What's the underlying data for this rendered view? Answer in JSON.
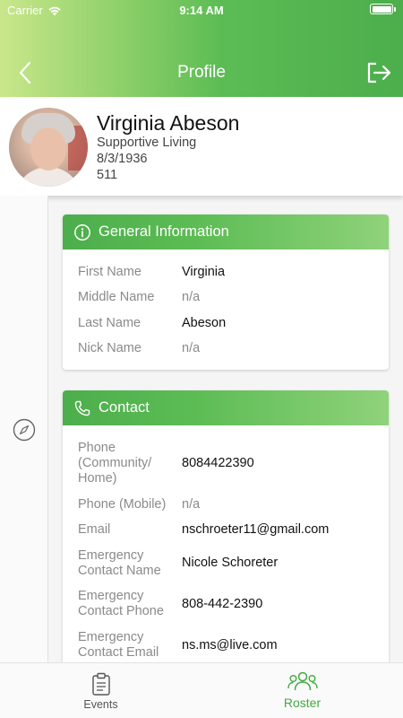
{
  "status": {
    "carrier": "Carrier",
    "time": "9:14 AM",
    "battery_level": 1.0
  },
  "nav": {
    "title": "Profile",
    "back_icon": "chevron-left-icon",
    "logout_icon": "logout-icon"
  },
  "profile": {
    "name": "Virginia Abeson",
    "community": "Supportive Living",
    "birthdate": "8/3/1936",
    "room": "511"
  },
  "general": {
    "title": "General Information",
    "icon": "info-icon",
    "rows": [
      {
        "label": "First Name",
        "value": "Virginia"
      },
      {
        "label": "Middle Name",
        "value": "n/a"
      },
      {
        "label": "Last Name",
        "value": "Abeson"
      },
      {
        "label": "Nick Name",
        "value": "n/a"
      }
    ]
  },
  "contact": {
    "title": "Contact",
    "icon": "phone-icon",
    "rows": [
      {
        "label": "Phone (Community/ Home)",
        "value": "8084422390"
      },
      {
        "label": "Phone (Mobile)",
        "value": "n/a"
      },
      {
        "label": "Email",
        "value": "nschroeter11@gmail.com"
      },
      {
        "label": "Emergency Contact Name",
        "value": "Nicole Schoreter"
      },
      {
        "label": "Emergency Contact Phone",
        "value": "808-442-2390"
      },
      {
        "label": "Emergency Contact Email",
        "value": "ns.ms@live.com"
      }
    ]
  },
  "tabs": [
    {
      "label": "Events",
      "icon": "clipboard-icon",
      "active": false
    },
    {
      "label": "Roster",
      "icon": "group-icon",
      "active": true
    }
  ],
  "colors": {
    "accent": "#4cae4c",
    "active_tab": "#43a843",
    "inactive_tab": "#555555"
  }
}
